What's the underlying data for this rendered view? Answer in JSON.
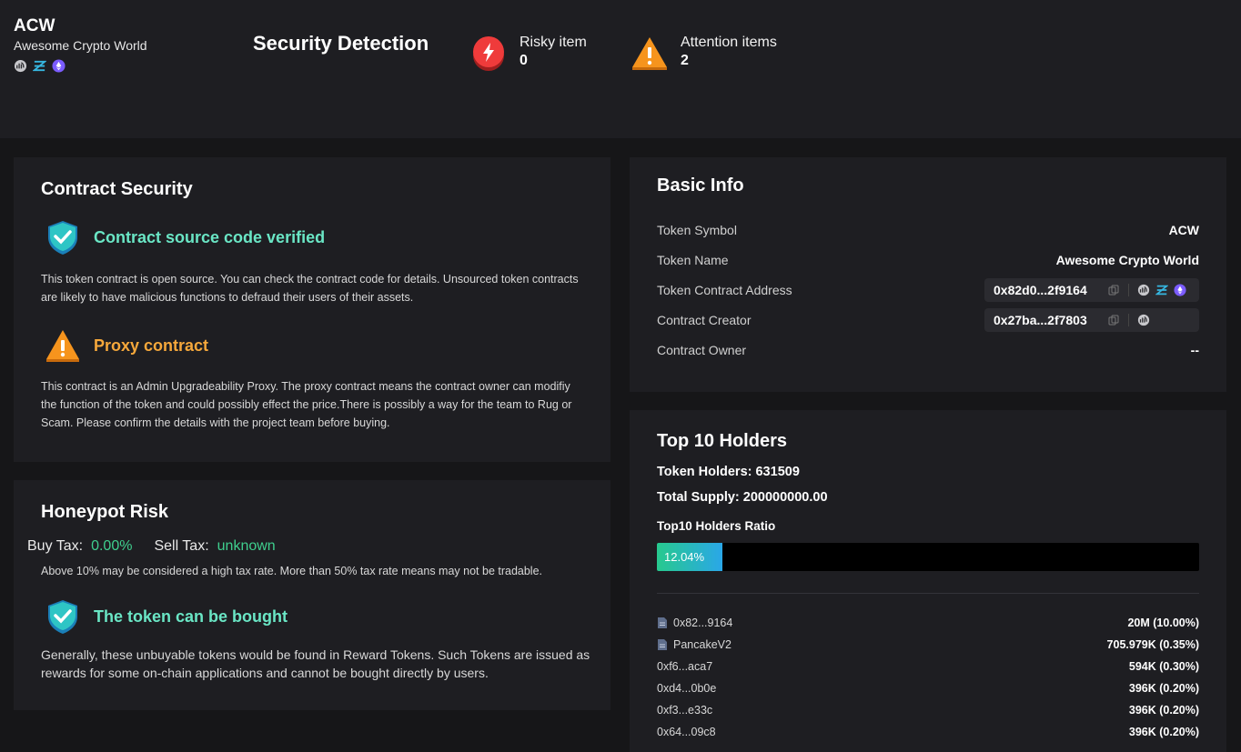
{
  "token": {
    "symbol": "ACW",
    "name": "Awesome Crypto World",
    "chain_icons": [
      "bscscan-icon",
      "hecoinfo-icon",
      "ethereum-purple-icon"
    ]
  },
  "header": {
    "title": "Security Detection",
    "risky": {
      "label": "Risky item",
      "value": "0"
    },
    "attention": {
      "label": "Attention items",
      "value": "2"
    }
  },
  "contract_security": {
    "title": "Contract Security",
    "verified": {
      "title": "Contract source code verified",
      "desc": "This token contract is open source. You can check the contract code for details. Unsourced token contracts are likely to have malicious functions to defraud their users of their assets."
    },
    "proxy": {
      "title": "Proxy contract",
      "desc": "This contract is an Admin Upgradeability Proxy. The proxy contract means the contract owner can modifiy the function of the token and could possibly effect the price.There is possibly a way for the team to Rug or Scam. Please confirm the details with the project team before buying."
    }
  },
  "honeypot": {
    "title": "Honeypot Risk",
    "buy_tax_label": "Buy Tax:",
    "buy_tax_value": "0.00%",
    "sell_tax_label": "Sell Tax:",
    "sell_tax_value": "unknown",
    "tax_note": "Above 10% may be considered a high tax rate. More than 50% tax rate means may not be tradable.",
    "bought": {
      "title": "The token can be bought",
      "desc": "Generally, these unbuyable tokens would be found in Reward Tokens. Such Tokens are issued as rewards for some on-chain applications and cannot be bought directly by users."
    }
  },
  "basic_info": {
    "title": "Basic Info",
    "symbol_label": "Token Symbol",
    "symbol_value": "ACW",
    "name_label": "Token Name",
    "name_value": "Awesome Crypto World",
    "contract_label": "Token Contract Address",
    "contract_value": "0x82d0...2f9164",
    "creator_label": "Contract Creator",
    "creator_value": "0x27ba...2f7803",
    "owner_label": "Contract Owner",
    "owner_value": "--"
  },
  "holders": {
    "title": "Top 10 Holders",
    "count_line": "Token Holders: 631509",
    "supply_line": "Total Supply: 200000000.00",
    "ratio_label": "Top10 Holders Ratio",
    "ratio_text": "12.04%",
    "ratio_fraction": 0.1204,
    "list": [
      {
        "addr": "0x82...9164",
        "amount": "20M  (10.00%)",
        "contract": true
      },
      {
        "addr": "PancakeV2",
        "amount": "705.979K  (0.35%)",
        "contract": true
      },
      {
        "addr": "0xf6...aca7",
        "amount": "594K  (0.30%)",
        "contract": false
      },
      {
        "addr": "0xd4...0b0e",
        "amount": "396K  (0.20%)",
        "contract": false
      },
      {
        "addr": "0xf3...e33c",
        "amount": "396K  (0.20%)",
        "contract": false
      },
      {
        "addr": "0x64...09c8",
        "amount": "396K  (0.20%)",
        "contract": false
      }
    ]
  },
  "colors": {
    "accent_green": "#6ae6c5",
    "accent_orange": "#f6a83b",
    "tax_green": "#3fcf8e",
    "risk_red": "#ef3b3b"
  }
}
